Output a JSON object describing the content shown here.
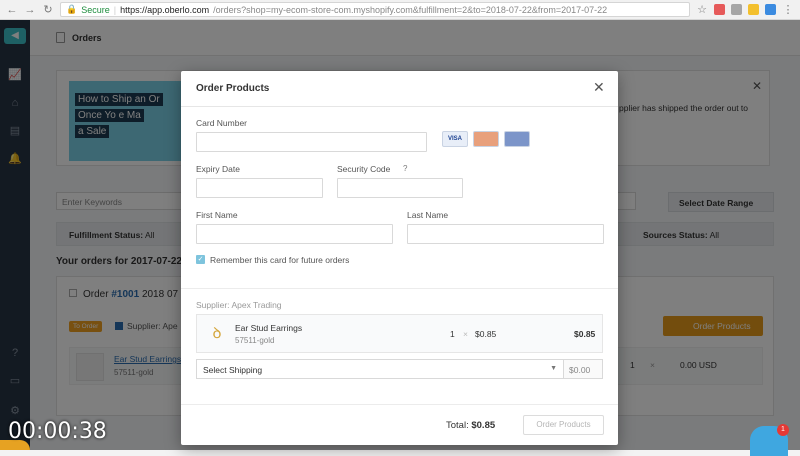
{
  "browser": {
    "secure_label": "Secure",
    "url_host": "https://app.oberlo.com",
    "url_rest": "/orders?shop=my-ecom-store-com.myshopify.com&fulfillment=2&to=2018-07-22&from=2017-07-22"
  },
  "app": {
    "page_title": "Orders",
    "banner": {
      "video_line1": "How to Ship an Or",
      "video_line2": "Once Yo     e Ma",
      "video_line3": "a Sale",
      "text": "pplier has shipped the order out to"
    },
    "search_placeholder": "Enter Keywords",
    "date_range_label": "Select Date Range",
    "filters": {
      "fulfillment_label": "Fulfillment Status:",
      "fulfillment_value": "All",
      "sources_label": "Sources Status:",
      "sources_value": "All"
    },
    "orders_heading": "Your orders for 2017-07-22 -",
    "order": {
      "prefix": "Order",
      "number": "#1001",
      "date": "2018 07",
      "badge": "To Order",
      "supplier": "Supplier: Ape",
      "order_button": "Order Products",
      "item_name": "Ear Stud Earrings",
      "item_sku": "57511-gold",
      "qty": "1",
      "times": "×",
      "price": "0.00 USD"
    }
  },
  "modal": {
    "title": "Order Products",
    "card_number_label": "Card Number",
    "expiry_label": "Expiry Date",
    "security_label": "Security Code",
    "security_help": "?",
    "first_name_label": "First Name",
    "last_name_label": "Last Name",
    "card_logos": [
      {
        "name": "VISA",
        "color": "#e8eef8"
      },
      {
        "name": "MC",
        "color": "#e8a07c"
      },
      {
        "name": "MAESTRO",
        "color": "#7c95c9"
      }
    ],
    "remember_label": "Remember this card for future orders",
    "remember_checked": true,
    "supplier_label": "Supplier: Apex Trading",
    "item": {
      "name": "Ear Stud Earrings",
      "sku": "57511-gold",
      "qty": "1",
      "times": "×",
      "price": "$0.85",
      "total": "$0.85"
    },
    "shipping_placeholder": "Select Shipping",
    "shipping_cost": "$0.00",
    "total_label": "Total:",
    "total_value": "$0.85",
    "order_button": "Order Products"
  },
  "overlay": {
    "timer": "00:00:38",
    "chat_badge": "1"
  },
  "colors": {
    "accent": "#3cc0c8",
    "sidebar": "#273444",
    "order_button": "#e69b1a",
    "link": "#2a6db0"
  }
}
